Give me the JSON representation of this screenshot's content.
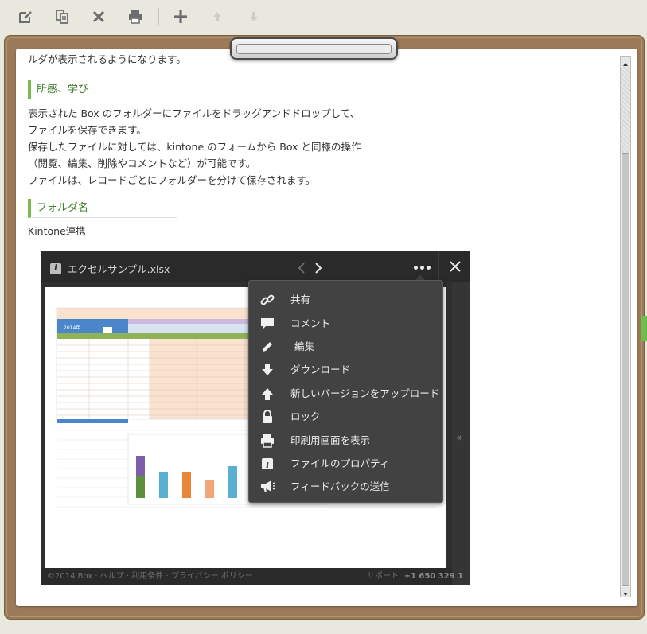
{
  "toolbar": {
    "buttons": [
      {
        "name": "edit",
        "icon": "edit-icon"
      },
      {
        "name": "copy",
        "icon": "copy-icon"
      },
      {
        "name": "delete",
        "icon": "close-icon"
      },
      {
        "name": "print",
        "icon": "print-icon"
      },
      {
        "name": "add",
        "icon": "plus-icon"
      },
      {
        "name": "move-up",
        "icon": "arrow-up-icon"
      },
      {
        "name": "move-down",
        "icon": "arrow-down-icon"
      }
    ]
  },
  "record": {
    "cut_text": "ルダが表示されるようになります。",
    "section1": {
      "title": "所感、学び",
      "lines": [
        "表示された Box のフォルダーにファイルをドラッグアンドドロップして、",
        "ファイルを保存できます。",
        "保存したファイルに対しては、kintone のフォームから Box と同様の操作",
        "（閲覧、編集、削除やコメントなど）が可能です。",
        "ファイルは、レコードごとにフォルダーを分けて保存されます。"
      ]
    },
    "section2": {
      "title": "フォルダ名",
      "value": "Kintone連携"
    }
  },
  "viewer": {
    "file_name": "エクセルサンプル.xlsx",
    "sheet_year": "2014年",
    "footer_left": "©2014 Box · ヘルプ · 利用条件 · プライバシー ポリシー",
    "footer_support_label": "サポート: ",
    "footer_support_phone": "+1 650 329 1",
    "collapse_glyph": "«",
    "menu": {
      "items": [
        {
          "label": "共有",
          "icon": "link-icon"
        },
        {
          "label": "コメント",
          "icon": "comment-icon"
        },
        {
          "label": "編集",
          "icon": "pencil-icon"
        },
        {
          "label": "ダウンロード",
          "icon": "download-icon"
        },
        {
          "label": "新しいバージョンをアップロード",
          "icon": "upload-icon"
        },
        {
          "label": "ロック",
          "icon": "lock-icon"
        },
        {
          "label": "印刷用画面を表示",
          "icon": "print-icon"
        },
        {
          "label": "ファイルのプロパティ",
          "icon": "info-icon"
        },
        {
          "label": "フィードバックの送信",
          "icon": "megaphone-icon"
        }
      ]
    }
  },
  "colors": {
    "heading_accent": "#7ab855",
    "heading_text": "#3f7d2c",
    "viewer_bg": "#2f2f2f",
    "menu_bg": "#424242",
    "board": "#9a7a58"
  }
}
